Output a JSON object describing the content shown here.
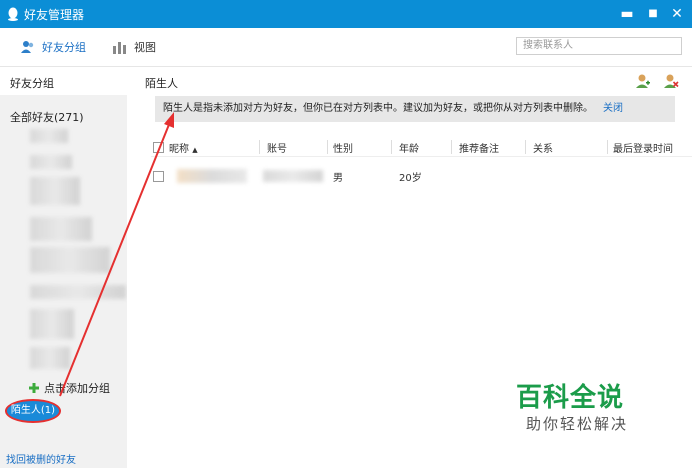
{
  "window": {
    "title": "好友管理器",
    "minimize": "▬",
    "maximize": "■",
    "close": "✕"
  },
  "toolbar": {
    "groups_label": "好友分组",
    "view_label": "视图",
    "search_placeholder": "搜索联系人"
  },
  "sidebar": {
    "header": "好友分组",
    "all_friends": "全部好友(271)",
    "add_group": "点击添加分组",
    "stranger_group": "陌生人(1)",
    "recover_link": "找回被删的好友"
  },
  "main": {
    "title": "陌生人",
    "notice": "陌生人是指未添加对方为好友，但你已在对方列表中。建议加为好友，或把你从对方列表中删除。",
    "notice_close": "关闭",
    "columns": [
      "昵称",
      "账号",
      "性别",
      "年龄",
      "推荐备注",
      "关系",
      "最后登录时间"
    ],
    "rows": [
      {
        "gender": "男",
        "age": "20岁"
      }
    ]
  },
  "watermark": {
    "title": "百科全说",
    "subtitle": "助你轻松解决"
  },
  "colors": {
    "titlebar": "#0b8ed6",
    "accent": "#1a8ad8",
    "highlight": "#e53030",
    "watermark": "#1b9c4a"
  }
}
